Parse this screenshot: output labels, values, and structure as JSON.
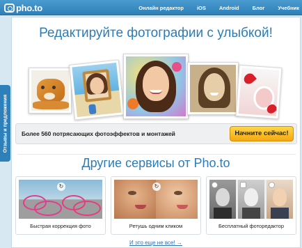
{
  "header": {
    "logo_text": "pho.to",
    "nav": [
      "Онлайн редактор",
      "iOS",
      "Android",
      "Блог",
      "Учебник"
    ]
  },
  "feedback_tab": {
    "label": "Отзывы и предложения"
  },
  "hero": {
    "title": "Редактируйте фотографии с улыбкой!",
    "cta_text": "Более 560 потрясающих фотоэффектов и монтажей",
    "cta_button": "Начните сейчас!"
  },
  "services_section": {
    "title": "Другие сервисы от Pho.to",
    "items": [
      {
        "label": "Быстрая коррекция фото"
      },
      {
        "label": "Ретушь одним кликом"
      },
      {
        "label": "Бесплатный фоторедактор"
      }
    ],
    "more_link": "И это еще не все! →"
  },
  "colors": {
    "nav_bg": "#2f7fb8",
    "title": "#2a7db8",
    "cta_button": "#f4a911"
  }
}
